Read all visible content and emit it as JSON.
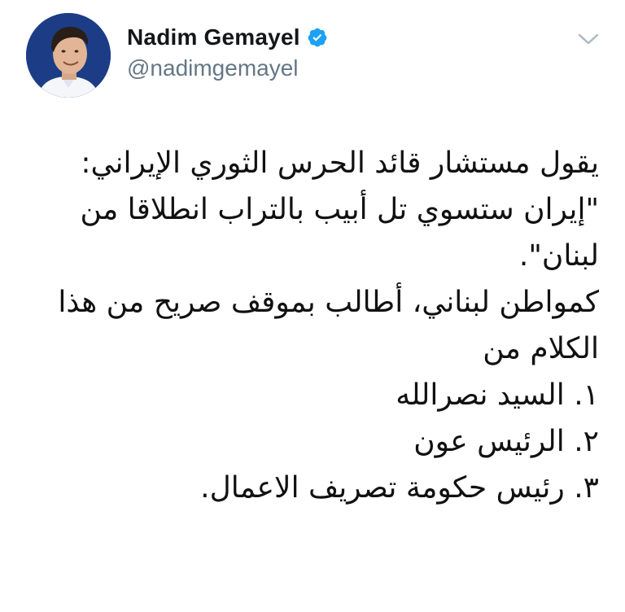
{
  "author": {
    "display_name": "Nadim Gemayel",
    "handle": "@nadimgemayel",
    "verified": true,
    "avatar_icon": "profile-photo",
    "verified_icon": "verified-badge-icon",
    "verified_color": "#1da1f2",
    "avatar_bg_color": "#1c3d86"
  },
  "menu": {
    "icon": "chevron-down-icon",
    "color": "#aab8c2"
  },
  "tweet": {
    "lines": [
      "يقول مستشار قائد الحرس الثوري الإيراني:",
      "\"إيران ستسوي تل أبيب بالتراب انطلاقا من",
      "لبنان\".",
      "كمواطن لبناني، أطالب بموقف صريح من هذا",
      "الكلام من",
      "١. السيد نصرالله",
      "٢. الرئيس عون",
      "٣. رئيس حكومة تصريف الاعمال."
    ]
  }
}
